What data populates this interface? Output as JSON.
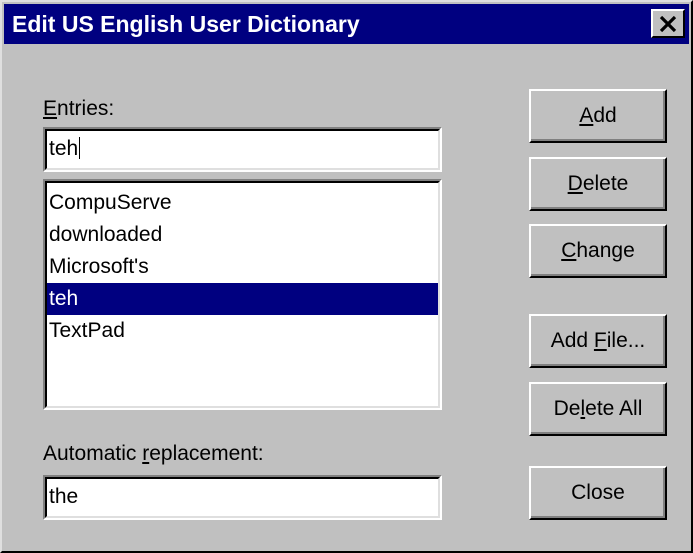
{
  "window": {
    "title": "Edit US English User Dictionary",
    "close_icon": "close-icon"
  },
  "entries": {
    "label_mnemonic": "E",
    "label_rest": "ntries:",
    "input_value": "teh",
    "items": [
      {
        "label": "CompuServe",
        "selected": false
      },
      {
        "label": "downloaded",
        "selected": false
      },
      {
        "label": "Microsoft's",
        "selected": false
      },
      {
        "label": "teh",
        "selected": true
      },
      {
        "label": "TextPad",
        "selected": false
      }
    ]
  },
  "replacement": {
    "label_before": "Automatic ",
    "label_mnemonic": "r",
    "label_after": "eplacement:",
    "input_value": "the"
  },
  "buttons": {
    "add": {
      "before": "",
      "mnemonic": "A",
      "after": "dd"
    },
    "delete": {
      "before": "",
      "mnemonic": "D",
      "after": "elete"
    },
    "change": {
      "before": "",
      "mnemonic": "C",
      "after": "hange"
    },
    "add_file": {
      "before": "Add ",
      "mnemonic": "F",
      "after": "ile..."
    },
    "delete_all": {
      "before": "De",
      "mnemonic": "l",
      "after": "ete All"
    },
    "close": {
      "before": "Close",
      "mnemonic": "",
      "after": ""
    }
  },
  "colors": {
    "titlebar": "#000080",
    "selection": "#000080",
    "face": "#c0c0c0"
  }
}
